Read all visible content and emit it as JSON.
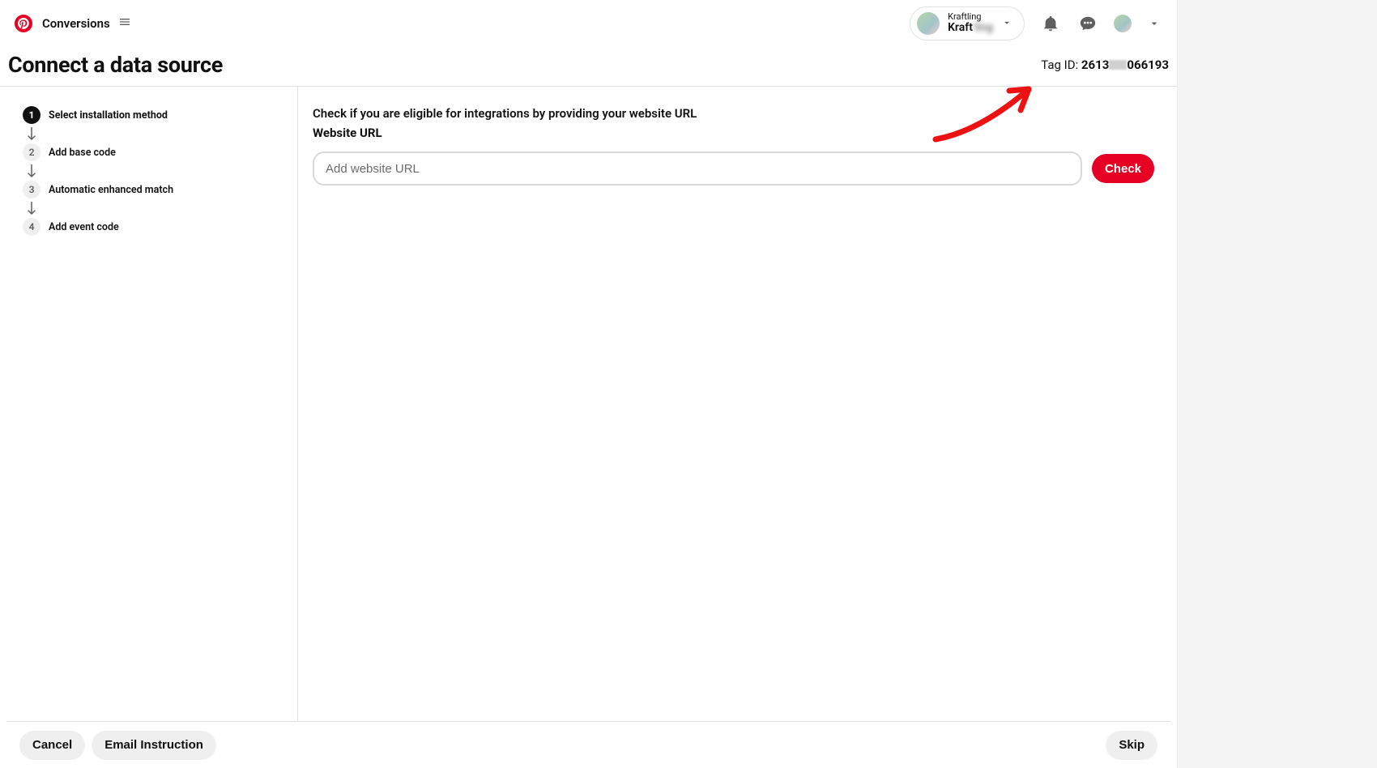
{
  "header": {
    "section_label": "Conversions",
    "account": {
      "name_small": "Kraftling",
      "name_main_prefix": "Kraft",
      "name_main_blur": "ling"
    }
  },
  "page": {
    "title": "Connect a data source",
    "tag_id_label": "Tag ID: ",
    "tag_id_prefix": "2613",
    "tag_id_suffix": "066193"
  },
  "steps": [
    {
      "num": "1",
      "label": "Select installation method",
      "active": true
    },
    {
      "num": "2",
      "label": "Add base code",
      "active": false
    },
    {
      "num": "3",
      "label": "Automatic enhanced match",
      "active": false
    },
    {
      "num": "4",
      "label": "Add event code",
      "active": false
    }
  ],
  "main": {
    "instruction": "Check if you are eligible for integrations by providing your website URL",
    "website_url_label": "Website URL",
    "url_placeholder": "Add website URL",
    "check_label": "Check"
  },
  "footer": {
    "cancel": "Cancel",
    "email_instruction": "Email Instruction",
    "skip": "Skip"
  }
}
